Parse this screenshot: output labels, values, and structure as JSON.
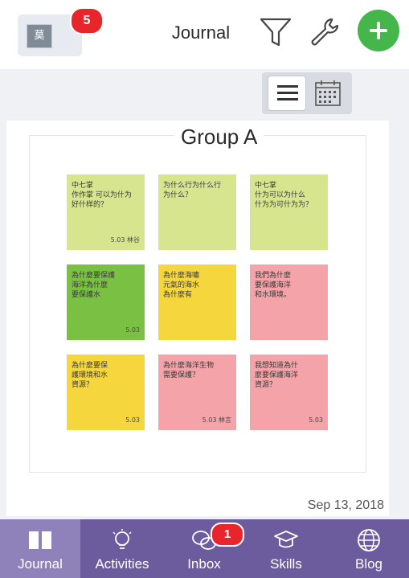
{
  "header": {
    "avatar_text": "莫",
    "notification_count": "5",
    "title": "Journal",
    "add_color": "#45b649"
  },
  "view_toggle": {
    "selected": "list"
  },
  "post": {
    "group_title": "Group A",
    "date": "Sep 13, 2018",
    "notes": [
      {
        "color": "#d6e58e",
        "text": "中七掌\n作作掌 可以为什为\n好什样的？",
        "signer": "5.03 林谷"
      },
      {
        "color": "#d6e58e",
        "text": "为什么行为什么行\n为什么？",
        "signer": ""
      },
      {
        "color": "#d6e58e",
        "text": "中七掌\n什为可以为什么\n什为为可什为为？",
        "signer": ""
      },
      {
        "color": "#7ac143",
        "text": "為什麼要保護\n海洋為什麼\n要保護水",
        "signer": "5.03"
      },
      {
        "color": "#f5d63d",
        "text": "為什麼海嘯\n元氣的海水\n為什麼有",
        "signer": ""
      },
      {
        "color": "#f4a3a8",
        "text": "我們為什麼\n要保護海洋\n和水環境。",
        "signer": ""
      },
      {
        "color": "#f5d63d",
        "text": "為什麼要保\n護環境和水\n資源？",
        "signer": "5.03"
      },
      {
        "color": "#f4a3a8",
        "text": "為什麼海洋生物\n需要保護？",
        "signer": "5.03 林言"
      },
      {
        "color": "#f4a3a8",
        "text": "我想知道為什\n麼要保護海洋\n資源？",
        "signer": "5.03"
      }
    ]
  },
  "nav": {
    "items": [
      {
        "label": "Journal",
        "active": true
      },
      {
        "label": "Activities",
        "active": false
      },
      {
        "label": "Inbox",
        "active": false
      },
      {
        "label": "Skills",
        "active": false
      },
      {
        "label": "Blog",
        "active": false
      }
    ],
    "inbox_count": "1",
    "bar_color": "#6c5c9d",
    "active_color": "#8f82bb"
  },
  "colors": {
    "notification_badge": "#e8252b",
    "content_background": "#f0f1f4"
  }
}
